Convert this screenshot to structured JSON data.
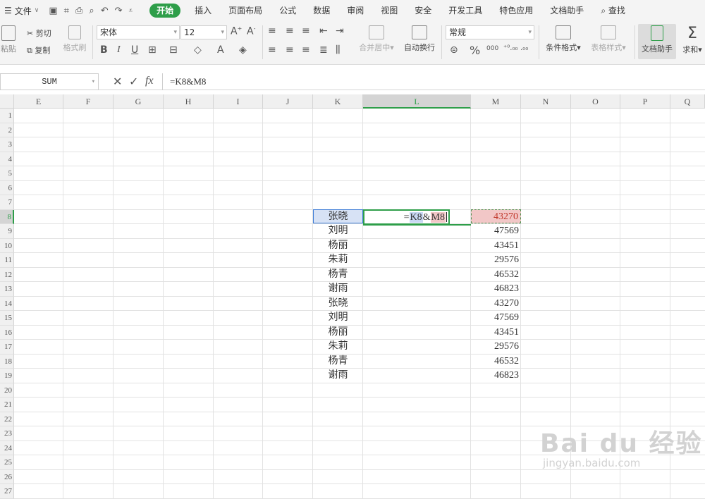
{
  "menubar": {
    "file_label": "文件",
    "tabs": [
      "开始",
      "插入",
      "页面布局",
      "公式",
      "数据",
      "审阅",
      "视图",
      "安全",
      "开发工具",
      "特色应用",
      "文档助手"
    ],
    "search_label": "查找",
    "active_tab_color": "#2e9e49"
  },
  "ribbon": {
    "paste_label": "粘贴",
    "cut_label": "剪切",
    "copy_label": "复制",
    "format_painter_label": "格式刷",
    "font_name": "宋体",
    "font_size": "12",
    "merge_center_label": "合并居中",
    "wrap_text_label": "自动换行",
    "number_format": "常规",
    "conditional_format_label": "条件格式",
    "table_style_label": "表格样式",
    "doc_helper_label": "文档助手",
    "sum_label": "求和",
    "percent_symbol": "%",
    "thousands_symbol": "000"
  },
  "formula_bar": {
    "name_box": "SUM",
    "formula": "=K8&M8"
  },
  "sheet": {
    "columns": [
      "E",
      "F",
      "G",
      "H",
      "I",
      "J",
      "K",
      "L",
      "M",
      "N",
      "O",
      "P",
      "Q"
    ],
    "selected_column": "L",
    "rows": [
      "1",
      "2",
      "3",
      "4",
      "5",
      "6",
      "7",
      "8",
      "9",
      "10",
      "11",
      "12",
      "13",
      "14",
      "15",
      "16",
      "17",
      "18",
      "19",
      "20",
      "21",
      "22",
      "23",
      "24",
      "25",
      "26",
      "27"
    ],
    "selected_row": "8",
    "editing_cell": {
      "address": "L8",
      "eq": "=",
      "ref1": "K8",
      "amp": "&",
      "ref2": "M8"
    },
    "data": [
      {
        "row": "8",
        "name": "张晓",
        "value": "43270"
      },
      {
        "row": "9",
        "name": "刘明",
        "value": "47569"
      },
      {
        "row": "10",
        "name": "杨丽",
        "value": "43451"
      },
      {
        "row": "11",
        "name": "朱莉",
        "value": "29576"
      },
      {
        "row": "12",
        "name": "杨青",
        "value": "46532"
      },
      {
        "row": "13",
        "name": "谢雨",
        "value": "46823"
      },
      {
        "row": "14",
        "name": "张晓",
        "value": "43270"
      },
      {
        "row": "15",
        "name": "刘明",
        "value": "47569"
      },
      {
        "row": "16",
        "name": "杨丽",
        "value": "43451"
      },
      {
        "row": "17",
        "name": "朱莉",
        "value": "29576"
      },
      {
        "row": "18",
        "name": "杨青",
        "value": "46532"
      },
      {
        "row": "19",
        "name": "谢雨",
        "value": "46823"
      }
    ]
  },
  "watermark": {
    "brand": "Bai du 经验",
    "url": "jingyan.baidu.com"
  }
}
